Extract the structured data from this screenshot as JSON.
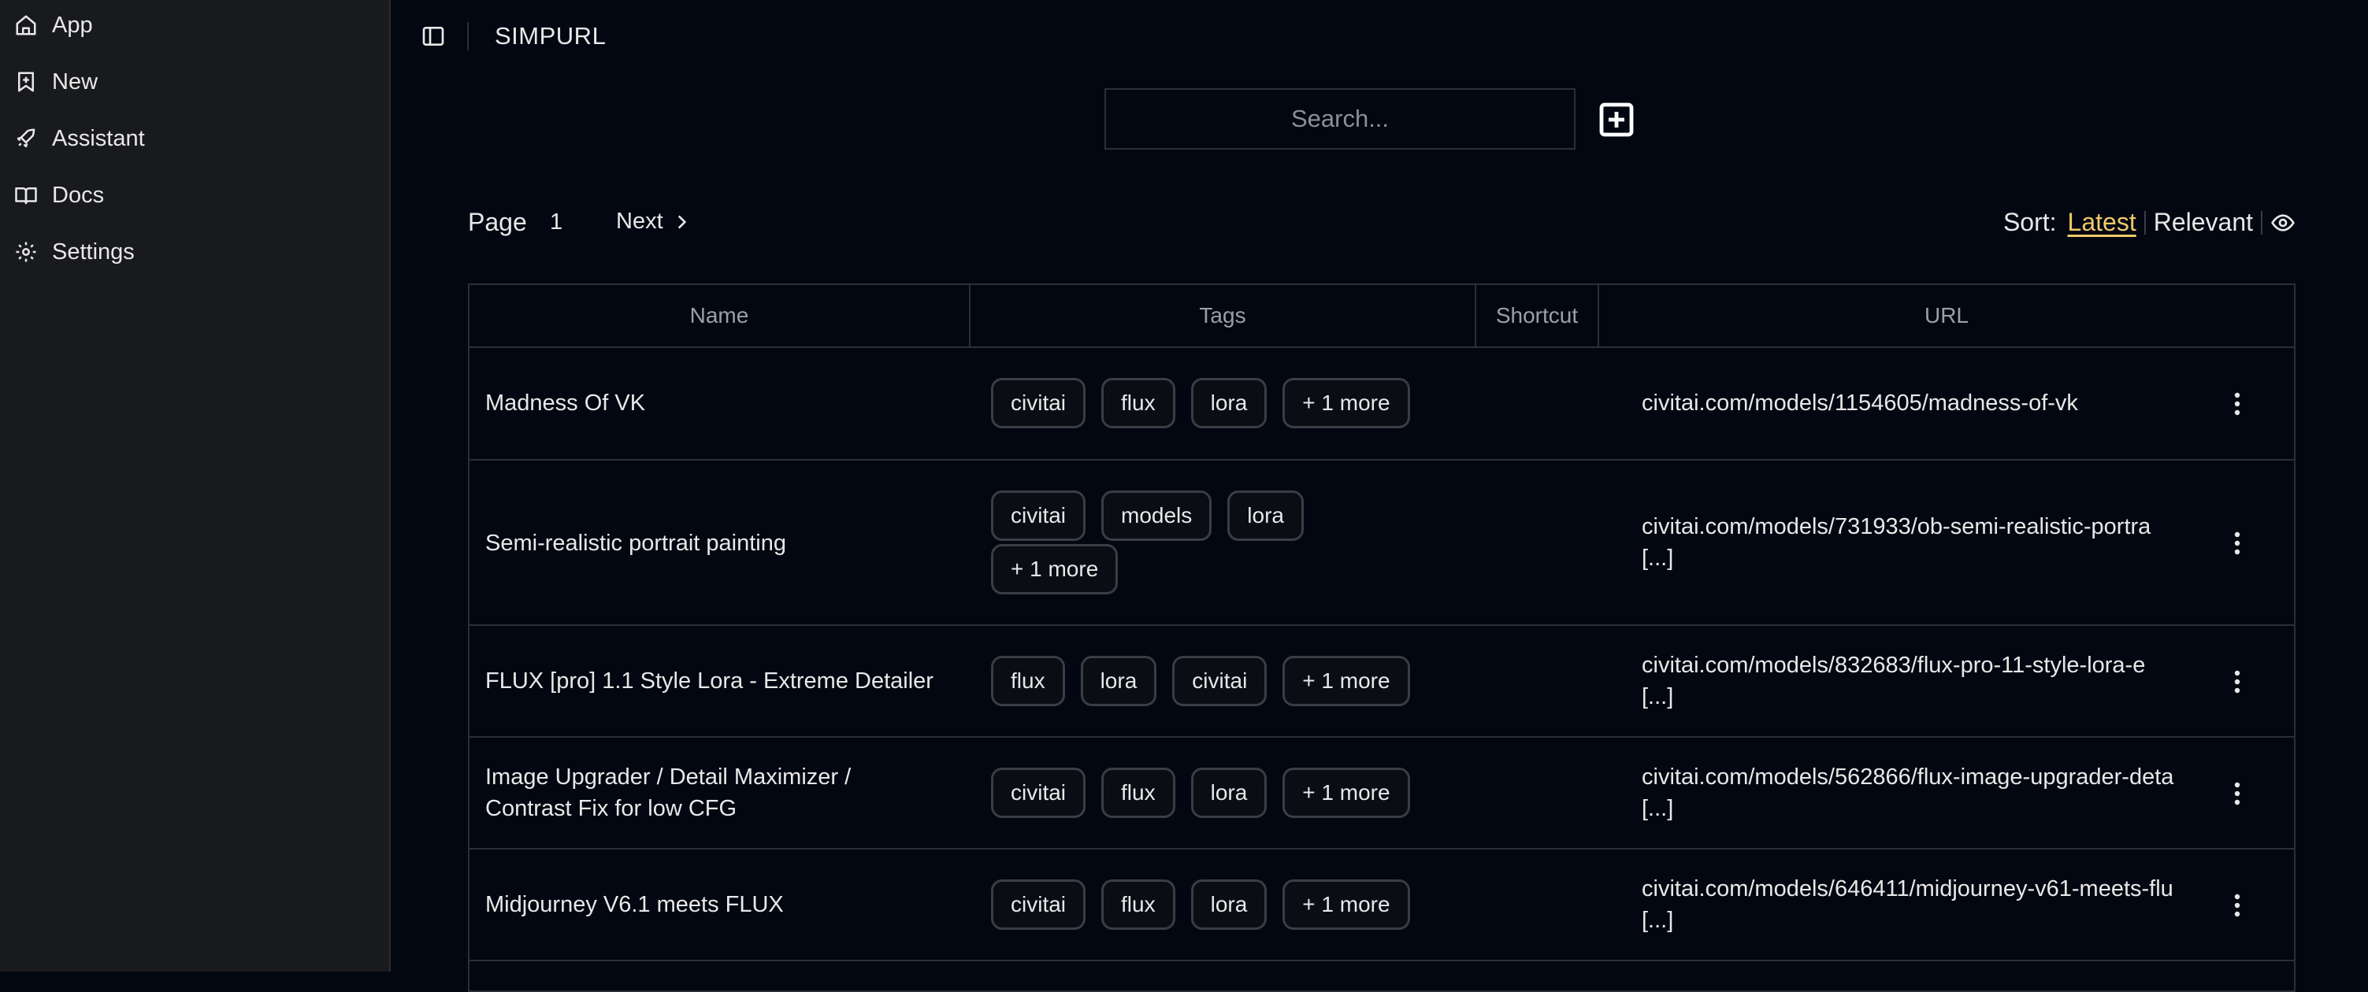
{
  "sidebar": {
    "items": [
      {
        "label": "App",
        "icon": "home-icon"
      },
      {
        "label": "New",
        "icon": "bookmark-plus-icon"
      },
      {
        "label": "Assistant",
        "icon": "rocket-icon"
      },
      {
        "label": "Docs",
        "icon": "book-icon"
      },
      {
        "label": "Settings",
        "icon": "gear-icon"
      }
    ]
  },
  "header": {
    "title": "SIMPURL"
  },
  "search": {
    "placeholder": "Search...",
    "value": ""
  },
  "pagination": {
    "label": "Page",
    "current": "1",
    "next": "Next"
  },
  "sort": {
    "label": "Sort:",
    "latest": "Latest",
    "relevant": "Relevant",
    "active": "Latest"
  },
  "table": {
    "headers": [
      "Name",
      "Tags",
      "Shortcut",
      "URL"
    ],
    "rows": [
      {
        "name": "Madness Of VK",
        "tags": [
          "civitai",
          "flux",
          "lora",
          "+ 1 more"
        ],
        "shortcut": "",
        "url": [
          "civitai.com/models/1154605/madness-of-vk"
        ]
      },
      {
        "name": "Semi-realistic portrait painting",
        "tags": [
          "civitai",
          "models",
          "lora",
          "+ 1 more"
        ],
        "shortcut": "",
        "url": [
          "civitai.com/models/731933/ob-semi-realistic-portra",
          "[...]"
        ]
      },
      {
        "name": "FLUX [pro] 1.1 Style Lora - Extreme Detailer",
        "tags": [
          "flux",
          "lora",
          "civitai",
          "+ 1 more"
        ],
        "shortcut": "",
        "url": [
          "civitai.com/models/832683/flux-pro-11-style-lora-e",
          "[...]"
        ]
      },
      {
        "name": "Image Upgrader / Detail Maximizer / Contrast Fix for low CFG",
        "tags": [
          "civitai",
          "flux",
          "lora",
          "+ 1 more"
        ],
        "shortcut": "",
        "url": [
          "civitai.com/models/562866/flux-image-upgrader-deta",
          "[...]"
        ]
      },
      {
        "name": "Midjourney V6.1 meets FLUX",
        "tags": [
          "civitai",
          "flux",
          "lora",
          "+ 1 more"
        ],
        "shortcut": "",
        "url": [
          "civitai.com/models/646411/midjourney-v61-meets-flu",
          "[...]"
        ]
      }
    ]
  },
  "colors": {
    "background": "#030711",
    "sidebar": "#191a1d",
    "accent": "#f0c96a",
    "border": "#2c2f36"
  }
}
